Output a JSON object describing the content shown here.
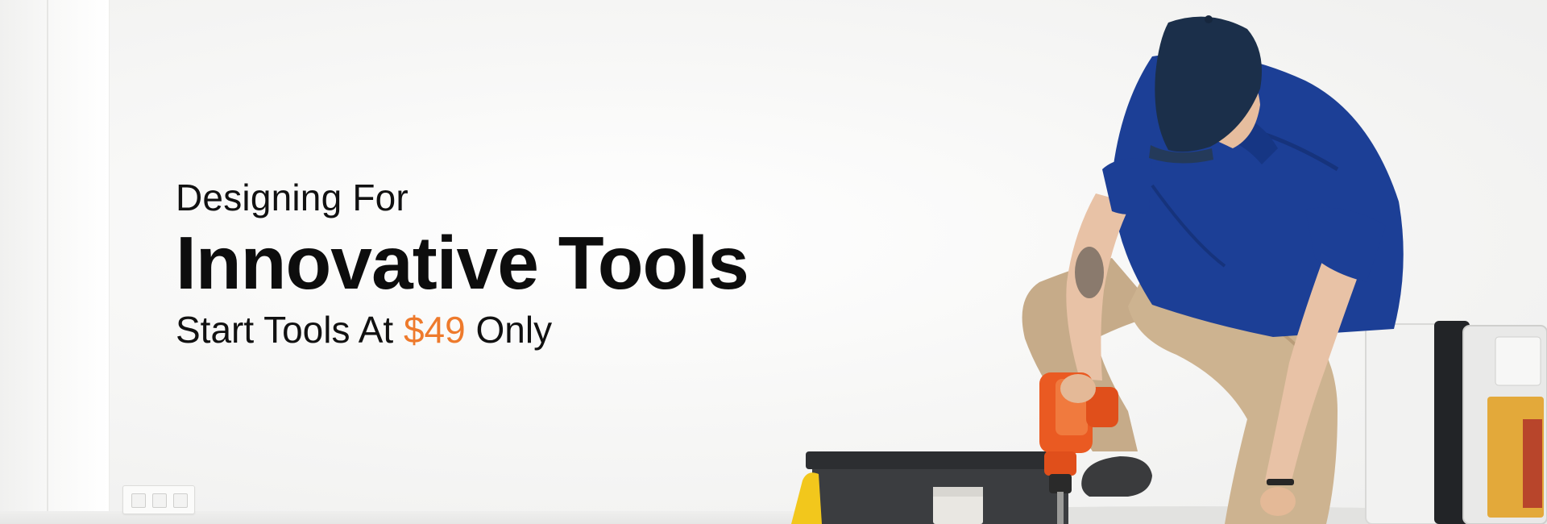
{
  "hero": {
    "pre_title": "Designing For",
    "main_title": "Innovative Tools",
    "sub_title": {
      "prefix": "Start Tools At",
      "price": "$49",
      "suffix": "Only"
    }
  },
  "colors": {
    "accent": "#ee7a2c",
    "text": "#111111",
    "shirt": "#1c3f96",
    "cap": "#1b2f4a",
    "pants": "#c9ae8b",
    "drill": "#ea5a22"
  },
  "illustration": {
    "subject": "technician kneeling with drill beside toolboxes"
  }
}
